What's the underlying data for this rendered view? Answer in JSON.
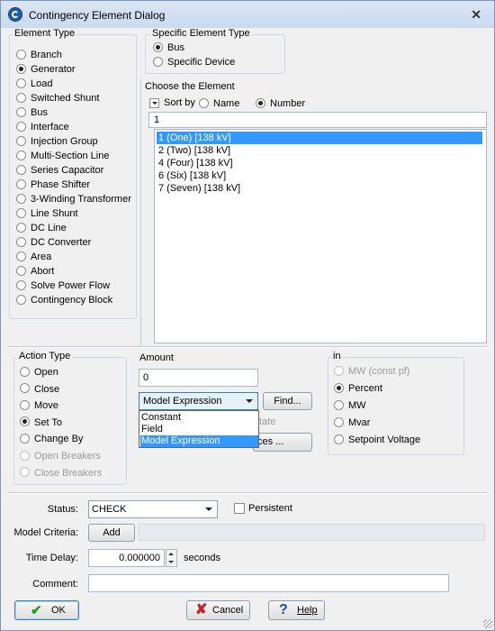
{
  "window": {
    "title": "Contingency Element Dialog",
    "close_symbol": "✕"
  },
  "element_type": {
    "title": "Element Type",
    "items": [
      "Branch",
      "Generator",
      "Load",
      "Switched Shunt",
      "Bus",
      "Interface",
      "Injection Group",
      "Multi-Section Line",
      "Series Capacitor",
      "Phase Shifter",
      "3-Winding Transformer",
      "Line Shunt",
      "DC Line",
      "DC Converter",
      "Area",
      "Abort",
      "Solve Power Flow",
      "Contingency Block"
    ],
    "selected": "Generator"
  },
  "specific_type": {
    "title": "Specific Element Type",
    "options": [
      "Bus",
      "Specific Device"
    ],
    "selected": "Bus"
  },
  "choose": {
    "title": "Choose the Element",
    "sort_by_label": "Sort by",
    "sort_options": [
      "Name",
      "Number"
    ],
    "sort_selected": "Number",
    "filter_value": "1",
    "items": [
      "1 (One) [138 kV]",
      "2 (Two) [138 kV]",
      "4 (Four) [138 kV]",
      "6 (Six) [138 kV]",
      "7 (Seven) [138 kV]"
    ],
    "selected_index": 0
  },
  "action_type": {
    "title": "Action Type",
    "options": [
      {
        "label": "Open",
        "enabled": true
      },
      {
        "label": "Close",
        "enabled": true
      },
      {
        "label": "Move",
        "enabled": true
      },
      {
        "label": "Set To",
        "enabled": true
      },
      {
        "label": "Change By",
        "enabled": true
      },
      {
        "label": "Open Breakers",
        "enabled": false
      },
      {
        "label": "Close Breakers",
        "enabled": false
      }
    ],
    "selected": "Set To"
  },
  "amount": {
    "title": "Amount",
    "value": "0",
    "combo_value": "Model Expression",
    "find_label": "Find...",
    "dropdown_options": [
      "Constant",
      "Field",
      "Model Expression"
    ],
    "dropdown_selected": "Model Expression",
    "hidden_text_fragment": "tate",
    "hidden_button_fragment": "ces ..."
  },
  "in_group": {
    "title": "in",
    "options": [
      {
        "label": "MW (const pf)",
        "enabled": false
      },
      {
        "label": "Percent",
        "enabled": true
      },
      {
        "label": "MW",
        "enabled": true
      },
      {
        "label": "Mvar",
        "enabled": true
      },
      {
        "label": "Setpoint Voltage",
        "enabled": true
      }
    ],
    "selected": "Percent"
  },
  "status": {
    "label": "Status:",
    "value": "CHECK",
    "persistent_label": "Persistent",
    "persistent_checked": false
  },
  "model_criteria": {
    "label": "Model Criteria:",
    "add_label": "Add"
  },
  "time_delay": {
    "label": "Time Delay:",
    "value": "0.000000",
    "units": "seconds"
  },
  "comment": {
    "label": "Comment:",
    "value": ""
  },
  "buttons": {
    "ok": "OK",
    "cancel": "Cancel",
    "help": "Help"
  },
  "colors": {
    "selection": "#3399ff",
    "title_bar": "#c9d9ee",
    "ok_icon": "#1e9c1e",
    "cancel_icon": "#c62020",
    "help_icon": "#1d4fa8"
  }
}
